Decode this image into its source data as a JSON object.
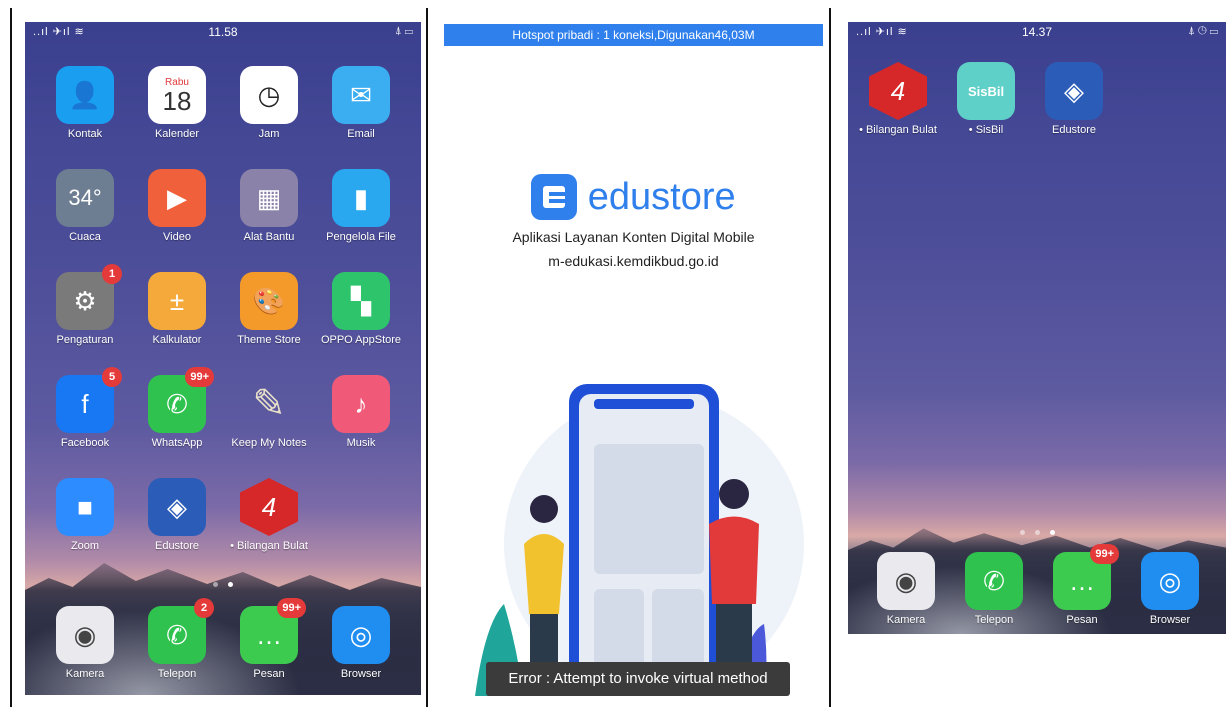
{
  "left_screen": {
    "status": {
      "signal": "..ıl ✈ıl ≋",
      "time": "11.58",
      "icons_right": "⍋ ▭"
    },
    "apps": [
      {
        "label": "Kontak",
        "icon": "contact-icon",
        "color": "#1a9ef0"
      },
      {
        "label": "Kalender",
        "icon": "calendar-icon",
        "color": "#ffffff",
        "day": "Rabu",
        "date": "18"
      },
      {
        "label": "Jam",
        "icon": "clock-icon",
        "color": "#ffffff"
      },
      {
        "label": "Email",
        "icon": "mail-icon",
        "color": "#3aaef0"
      },
      {
        "label": "Cuaca",
        "icon": "weather-icon",
        "color": "#6d7d92",
        "temp": "34°"
      },
      {
        "label": "Video",
        "icon": "play-icon",
        "color": "#f0603a"
      },
      {
        "label": "Alat Bantu",
        "icon": "tools-folder-icon",
        "color": "#8a82a8"
      },
      {
        "label": "Pengelola File",
        "icon": "file-manager-icon",
        "color": "#29a8ef"
      },
      {
        "label": "Pengaturan",
        "icon": "settings-icon",
        "color": "#7a7a7a",
        "badge": "1"
      },
      {
        "label": "Kalkulator",
        "icon": "calculator-icon",
        "color": "#f4a93a"
      },
      {
        "label": "Theme Store",
        "icon": "palette-icon",
        "color": "#f39a2a"
      },
      {
        "label": "OPPO AppStore",
        "icon": "appstore-icon",
        "color": "#2ec46b"
      },
      {
        "label": "Facebook",
        "icon": "facebook-icon",
        "color": "#1877f2",
        "badge": "5"
      },
      {
        "label": "WhatsApp",
        "icon": "whatsapp-icon",
        "color": "#2fc24e",
        "badge": "99+"
      },
      {
        "label": "Keep My Notes",
        "icon": "notes-icon",
        "color": "transparent"
      },
      {
        "label": "Musik",
        "icon": "music-icon",
        "color": "#f05a78"
      },
      {
        "label": "Zoom",
        "icon": "zoom-icon",
        "color": "#2d8cff"
      },
      {
        "label": "Edustore",
        "icon": "edustore-icon",
        "color": "#2b5cb8"
      },
      {
        "label": "• Bilangan Bulat",
        "icon": "bilangan-bulat-icon",
        "color": "#d62828"
      }
    ],
    "dock": [
      {
        "label": "Kamera",
        "icon": "camera-icon",
        "color": "#e9e9ee"
      },
      {
        "label": "Telepon",
        "icon": "phone-icon",
        "color": "#2fc24e",
        "badge": "2"
      },
      {
        "label": "Pesan",
        "icon": "message-icon",
        "color": "#3ccb4f",
        "badge": "99+"
      },
      {
        "label": "Browser",
        "icon": "browser-icon",
        "color": "#1f8ef0"
      }
    ]
  },
  "middle_screen": {
    "hotspot": "Hotspot pribadi : 1 koneksi,Digunakan46,03M",
    "brand_word": "edustore",
    "tagline_1": "Aplikasi Layanan Konten Digital Mobile",
    "tagline_2": "m-edukasi.kemdikbud.go.id",
    "toast": "Error : Attempt to invoke virtual method",
    "accent": "#2f80ec"
  },
  "right_screen": {
    "status": {
      "signal": "..ıl ✈ıl ≋",
      "time": "14.37",
      "icons_right": "⍋ ◷ ▭"
    },
    "apps": [
      {
        "label": "• Bilangan Bulat",
        "icon": "bilangan-bulat-icon",
        "color": "#d62828"
      },
      {
        "label": "• SisBil",
        "icon": "sisbil-icon",
        "color": "#5fd0c7",
        "text": "SisBil"
      },
      {
        "label": "Edustore",
        "icon": "edustore-icon",
        "color": "#2b5cb8"
      }
    ],
    "dock": [
      {
        "label": "Kamera",
        "icon": "camera-icon",
        "color": "#e9e9ee"
      },
      {
        "label": "Telepon",
        "icon": "phone-icon",
        "color": "#2fc24e"
      },
      {
        "label": "Pesan",
        "icon": "message-icon",
        "color": "#3ccb4f",
        "badge": "99+"
      },
      {
        "label": "Browser",
        "icon": "browser-icon",
        "color": "#1f8ef0"
      }
    ]
  }
}
